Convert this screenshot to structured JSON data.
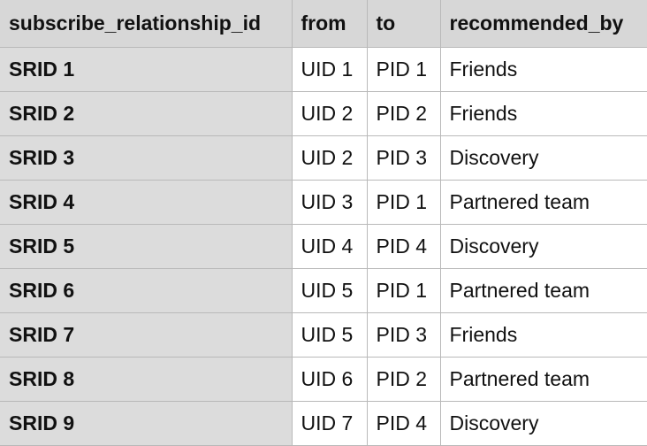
{
  "table": {
    "columns": [
      "subscribe_relationship_id",
      "from",
      "to",
      "recommended_by"
    ],
    "rows": [
      [
        "SRID 1",
        "UID 1",
        "PID 1",
        "Friends"
      ],
      [
        "SRID 2",
        "UID 2",
        "PID 2",
        "Friends"
      ],
      [
        "SRID 3",
        "UID 2",
        "PID 3",
        "Discovery"
      ],
      [
        "SRID 4",
        "UID 3",
        "PID 1",
        "Partnered team"
      ],
      [
        "SRID 5",
        "UID 4",
        "PID 4",
        "Discovery"
      ],
      [
        "SRID 6",
        "UID 5",
        "PID 1",
        "Partnered team"
      ],
      [
        "SRID 7",
        "UID 5",
        "PID 3",
        "Friends"
      ],
      [
        "SRID 8",
        "UID 6",
        "PID 2",
        "Partnered team"
      ],
      [
        "SRID 9",
        "UID 7",
        "PID 4",
        "Discovery"
      ]
    ]
  },
  "colors": {
    "header_bg": "#d7d7d7",
    "row_header_bg": "#dcdcdc",
    "cell_bg": "#ffffff",
    "border": "#b9b9b9"
  }
}
